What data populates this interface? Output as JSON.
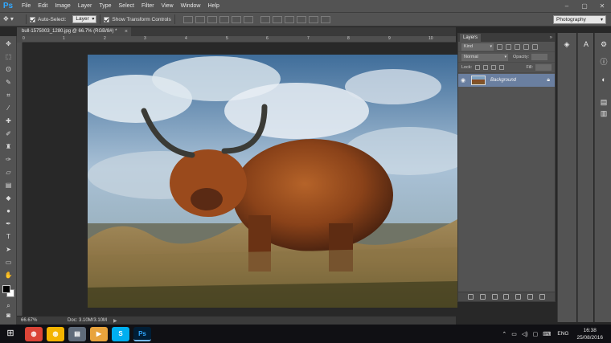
{
  "app": {
    "logo": "Ps",
    "menu": [
      "File",
      "Edit",
      "Image",
      "Layer",
      "Type",
      "Select",
      "Filter",
      "View",
      "Window",
      "Help"
    ],
    "window_controls": [
      "–",
      "▢",
      "✕"
    ]
  },
  "options_bar": {
    "tool_icon": "move-tool-icon",
    "auto_select_label": "Auto-Select:",
    "auto_select_checked": true,
    "auto_select_value": "Layer",
    "transform_controls_label": "Show Transform Controls",
    "transform_controls_checked": true,
    "workspace": "Photography"
  },
  "document": {
    "tab_title": "bull-1575003_1280.jpg @ 66.7% (RGB/8#) *",
    "tab_close": "×",
    "ruler_ticks": [
      "0",
      "1",
      "2",
      "3",
      "4",
      "5",
      "6",
      "7",
      "8",
      "9",
      "10"
    ],
    "zoom": "66.67%",
    "doc_size": "Doc: 3.10M/3.10M"
  },
  "layers_panel": {
    "tab_label": "Layers",
    "kind_filter": "Kind",
    "blend_mode": "Normal",
    "opacity_label": "Opacity:",
    "lock_label": "Lock:",
    "fill_label": "Fill:",
    "layers": [
      {
        "name": "Background",
        "visible": true,
        "locked": true
      }
    ]
  },
  "tools": [
    "move-tool-icon",
    "marquee-tool-icon",
    "lasso-tool-icon",
    "quick-select-tool-icon",
    "crop-tool-icon",
    "eyedropper-tool-icon",
    "healing-brush-icon",
    "brush-tool-icon",
    "clone-stamp-icon",
    "history-brush-icon",
    "eraser-tool-icon",
    "gradient-tool-icon",
    "blur-tool-icon",
    "dodge-tool-icon",
    "pen-tool-icon",
    "type-tool-icon",
    "path-select-icon",
    "shape-tool-icon",
    "hand-tool-icon",
    "zoom-tool-icon"
  ],
  "taskbar": {
    "apps": [
      "chrome-icon",
      "chrome-icon",
      "file-explorer-icon",
      "media-player-icon",
      "skype-icon",
      "photoshop-icon"
    ],
    "language": "ENG",
    "time": "16:38",
    "date": "25/08/2016"
  },
  "colors": {
    "ps_blue": "#31a8ff",
    "panel_bg": "#535353",
    "selected_layer": "#6a7fa0",
    "taskbar_bg": "#101014"
  }
}
